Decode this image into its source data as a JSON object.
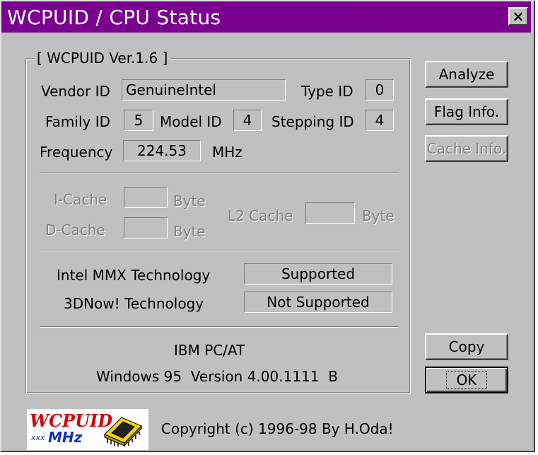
{
  "window": {
    "title": "WCPUID / CPU Status",
    "close_label": "×"
  },
  "group": {
    "legend": "[ WCPUID Ver.1.6 ]"
  },
  "cpu": {
    "vendor_label": "Vendor ID",
    "vendor_value": "GenuineIntel",
    "type_label": "Type ID",
    "type_value": "0",
    "family_label": "Family ID",
    "family_value": "5",
    "model_label": "Model ID",
    "model_value": "4",
    "stepping_label": "Stepping ID",
    "stepping_value": "4",
    "frequency_label": "Frequency",
    "frequency_value": "224.53",
    "frequency_unit": "MHz"
  },
  "cache": {
    "icache_label": "I-Cache",
    "icache_value": "",
    "icache_unit": "Byte",
    "dcache_label": "D-Cache",
    "dcache_value": "",
    "dcache_unit": "Byte",
    "l2_label": "L2 Cache",
    "l2_value": "",
    "l2_unit": "Byte"
  },
  "tech": {
    "mmx_label": "Intel MMX Technology",
    "mmx_value": "Supported",
    "now3d_label": "3DNow! Technology",
    "now3d_value": "Not Supported"
  },
  "system": {
    "machine": "IBM PC/AT",
    "os": "Windows 95  Version 4.00.1111  B"
  },
  "buttons": {
    "analyze": "Analyze",
    "flag_info": "Flag Info.",
    "cache_info": "Cache Info.",
    "copy": "Copy",
    "ok": "OK"
  },
  "logo": {
    "word": "WCPUID",
    "small": "xxx",
    "mhz": "MHz"
  },
  "footer": {
    "copyright": "Copyright (c) 1996-98  By H.Oda!"
  },
  "colors": {
    "titlebar": "#7a0090",
    "face": "#c0c0c0",
    "disabled_text": "#808080",
    "logo_red": "#d80000",
    "logo_blue": "#1030c0"
  }
}
